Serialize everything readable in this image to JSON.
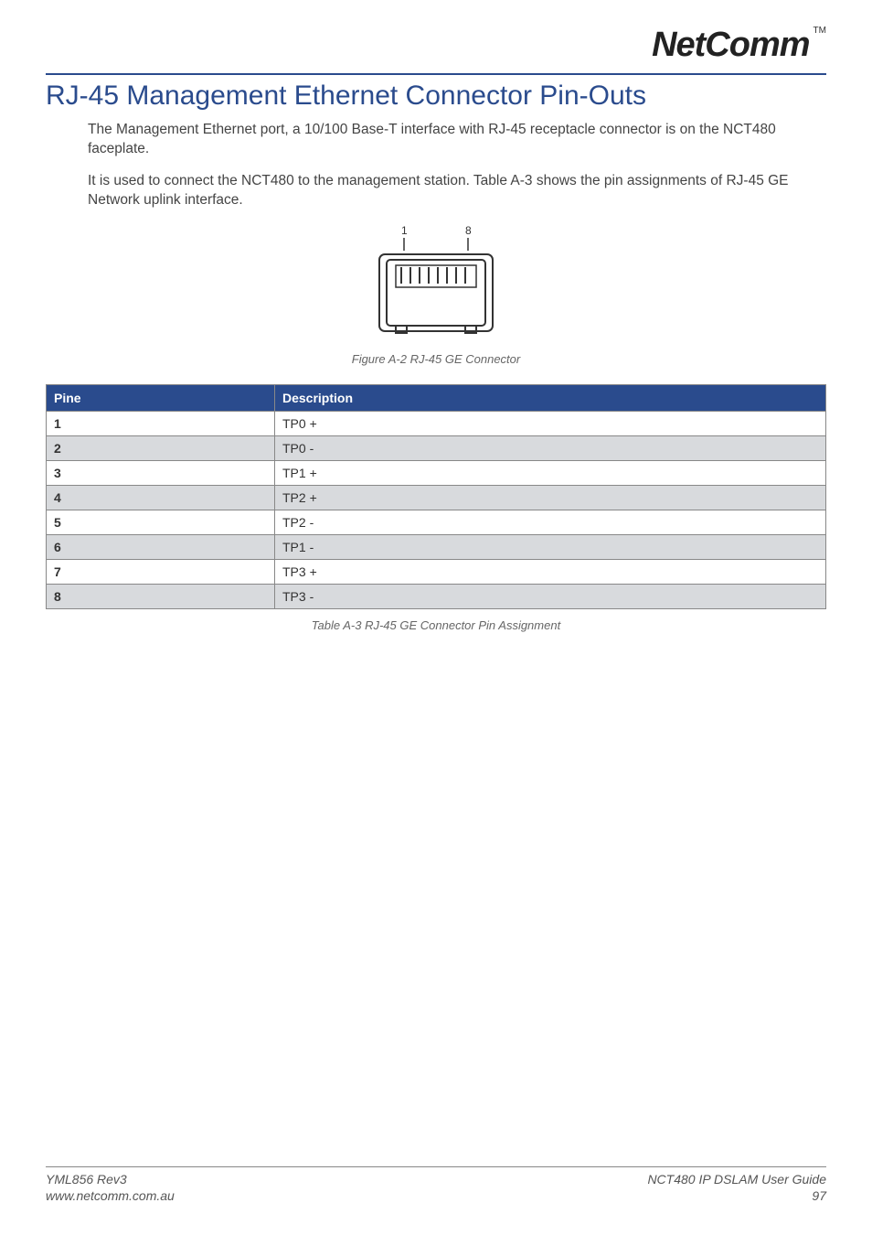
{
  "brand": {
    "name": "NetComm",
    "tm": "TM"
  },
  "title": "RJ-45 Management Ethernet Connector Pin-Outs",
  "para1": "The Management Ethernet port, a 10/100 Base-T interface with RJ-45 receptacle connector is on the NCT480 faceplate.",
  "para2": "It is used to connect the NCT480 to the management station. Table A-3 shows the pin assignments of RJ-45 GE Network uplink interface.",
  "figure_label_left": "1",
  "figure_label_right": "8",
  "figure_caption": "Figure A-2 RJ-45 GE Connector",
  "table": {
    "headers": {
      "c1": "Pine",
      "c2": "Description"
    },
    "rows": [
      {
        "pin": "1",
        "desc": "TP0 +"
      },
      {
        "pin": "2",
        "desc": "TP0 -"
      },
      {
        "pin": "3",
        "desc": "TP1 +"
      },
      {
        "pin": "4",
        "desc": "TP2 +"
      },
      {
        "pin": "5",
        "desc": "TP2 -"
      },
      {
        "pin": "6",
        "desc": "TP1 -"
      },
      {
        "pin": "7",
        "desc": "TP3 +"
      },
      {
        "pin": "8",
        "desc": "TP3 -"
      }
    ],
    "caption": "Table A-3 RJ-45 GE Connector Pin Assignment"
  },
  "footer": {
    "left1": "YML856 Rev3",
    "left2": "www.netcomm.com.au",
    "right1": "NCT480 IP DSLAM User Guide",
    "right2": "97"
  }
}
